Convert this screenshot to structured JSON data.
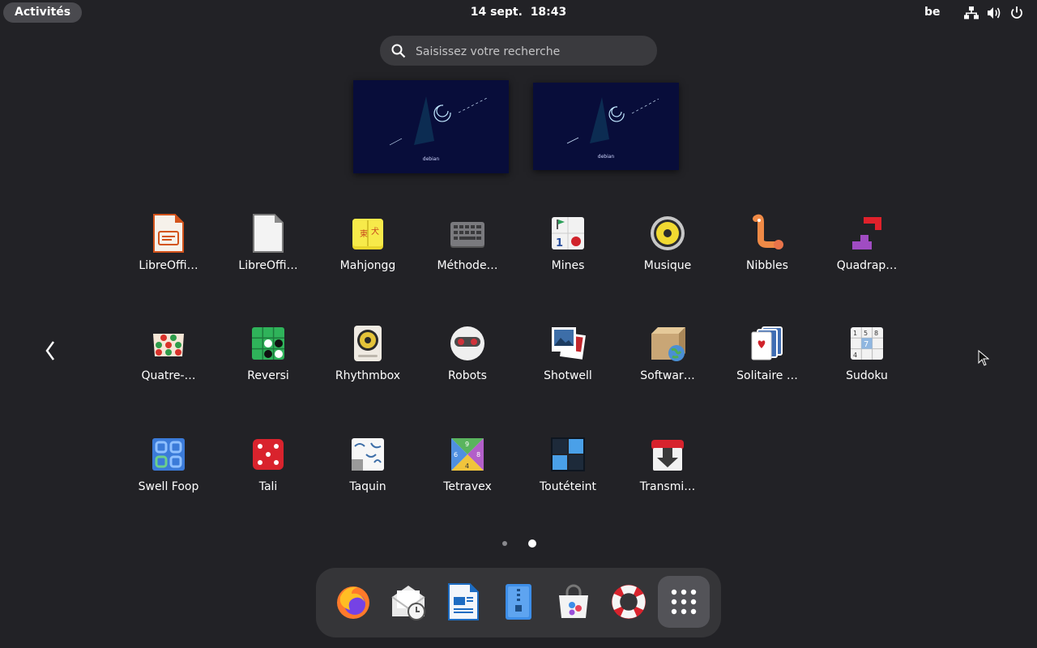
{
  "topbar": {
    "activities_label": "Activités",
    "date": "14 sept.",
    "time": "18:43",
    "keyboard_layout": "be"
  },
  "search": {
    "placeholder": "Saisissez votre recherche"
  },
  "workspaces": [
    {
      "label": "debian"
    },
    {
      "label": "debian"
    }
  ],
  "apps": [
    {
      "label": "LibreOffi…",
      "icon": "libreoffice-impress-icon"
    },
    {
      "label": "LibreOffi…",
      "icon": "libreoffice-startcenter-icon"
    },
    {
      "label": "Mahjongg",
      "icon": "mahjongg-icon"
    },
    {
      "label": "Méthode…",
      "icon": "keyboard-icon"
    },
    {
      "label": "Mines",
      "icon": "mines-icon"
    },
    {
      "label": "Musique",
      "icon": "music-speaker-icon"
    },
    {
      "label": "Nibbles",
      "icon": "nibbles-worm-icon"
    },
    {
      "label": "Quadrap…",
      "icon": "quadrapassel-icon"
    },
    {
      "label": "Quatre-…",
      "icon": "four-in-a-row-icon"
    },
    {
      "label": "Reversi",
      "icon": "reversi-icon"
    },
    {
      "label": "Rhythmbox",
      "icon": "rhythmbox-icon"
    },
    {
      "label": "Robots",
      "icon": "robots-icon"
    },
    {
      "label": "Shotwell",
      "icon": "shotwell-icon"
    },
    {
      "label": "Softwar…",
      "icon": "software-properties-icon"
    },
    {
      "label": "Solitaire …",
      "icon": "solitaire-cards-icon"
    },
    {
      "label": "Sudoku",
      "icon": "sudoku-icon"
    },
    {
      "label": "Swell Foop",
      "icon": "swell-foop-icon"
    },
    {
      "label": "Tali",
      "icon": "dice-icon"
    },
    {
      "label": "Taquin",
      "icon": "taquin-icon"
    },
    {
      "label": "Tetravex",
      "icon": "tetravex-icon"
    },
    {
      "label": "Toutéteint",
      "icon": "lights-off-icon"
    },
    {
      "label": "Transmi…",
      "icon": "transmission-icon"
    }
  ],
  "pagination": {
    "pages": 2,
    "current": 2
  },
  "dock": [
    {
      "name": "firefox",
      "icon": "firefox-icon"
    },
    {
      "name": "evolution",
      "icon": "mail-clock-icon"
    },
    {
      "name": "libreoffice-writer",
      "icon": "writer-document-icon"
    },
    {
      "name": "file-roller",
      "icon": "archive-zipper-icon"
    },
    {
      "name": "software",
      "icon": "software-bag-icon"
    },
    {
      "name": "help",
      "icon": "lifebuoy-icon"
    },
    {
      "name": "show-apps",
      "icon": "app-grid-icon"
    }
  ],
  "colors": {
    "background": "#222226",
    "panel_button": "#4a4a4f",
    "search_bg": "#3a3a3e",
    "dock_bg": "#353538",
    "workspace_bg": "#080d3a"
  }
}
